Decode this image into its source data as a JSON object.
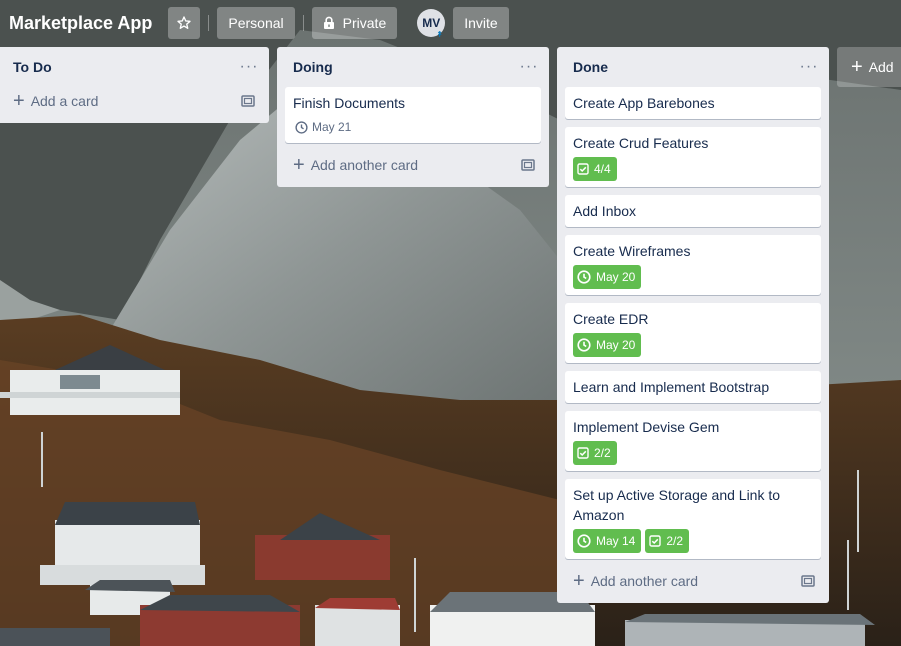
{
  "board": {
    "title": "Marketplace App",
    "star_icon": "star-icon",
    "workspace_label": "Personal",
    "visibility_label": "Private",
    "visibility_icon": "lock-icon",
    "member_initials": "MV",
    "invite_label": "Invite"
  },
  "lists": [
    {
      "title": "To Do",
      "menu_label": "···",
      "cards": [],
      "add_card_label": "Add a card"
    },
    {
      "title": "Doing",
      "menu_label": "···",
      "cards": [
        {
          "title": "Finish Documents",
          "due": "May 21"
        }
      ],
      "add_card_label": "Add another card"
    },
    {
      "title": "Done",
      "menu_label": "···",
      "cards": [
        {
          "title": "Create App Barebones"
        },
        {
          "title": "Create Crud Features",
          "checklist": "4/4"
        },
        {
          "title": "Add Inbox"
        },
        {
          "title": "Create Wireframes",
          "due": "May 20"
        },
        {
          "title": "Create EDR",
          "due": "May 20"
        },
        {
          "title": "Learn and Implement Bootstrap"
        },
        {
          "title": "Implement Devise Gem",
          "checklist": "2/2"
        },
        {
          "title": "Set up Active Storage and Link to Amazon",
          "due": "May 14",
          "checklist": "2/2"
        }
      ],
      "add_card_label": "Add another card"
    }
  ],
  "add_list_label": "Add",
  "colors": {
    "list_bg": "#ebecf0",
    "complete_badge": "#61bd4f",
    "header_button_bg": "rgba(255,255,255,0.3)"
  }
}
